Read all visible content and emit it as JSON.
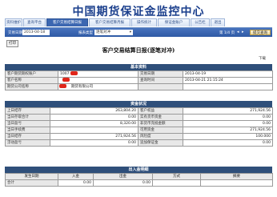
{
  "site_title": "中国期货保证金监控中心",
  "tabs": [
    "资料维护",
    "查询平台",
    "客户交易结算日报",
    "客户交易结算月报",
    "操作统计",
    "保证金账户",
    "公告栏",
    "退出"
  ],
  "active_tab": 2,
  "toolbar": {
    "date_label": "交易日期",
    "date_value": "2013-04-18",
    "type_label": "报表类型",
    "type_value": "逐笔对冲",
    "page_info": "第 1/4 页",
    "query_button": "提交查询"
  },
  "print_label": "打印",
  "report_title": "客户交易结算日报(逐笔对冲)",
  "download_label": "下载",
  "basic": {
    "heading": "基本资料",
    "rows": [
      [
        "客户期货期权账户",
        "1007",
        "交易日期",
        "2013-04-19"
      ],
      [
        "客户名称",
        "",
        "查询时间",
        "2013-04-21 21:15:24"
      ],
      [
        "期货公司名称",
        "",
        "",
        ""
      ]
    ],
    "company_suffix": "期货有限公司"
  },
  "funds": {
    "heading": "资金状况",
    "rows": [
      [
        "上日结存",
        "263,804.20",
        "客户权益",
        "271,924.56"
      ],
      [
        "当日存取合计",
        "0.00",
        "实有货币资金",
        "0.00"
      ],
      [
        "当日盈亏",
        "8,320.00",
        "非货币充抵金额",
        "0.00"
      ],
      [
        "当日手续费",
        "",
        "可用资金",
        "271,924.56"
      ],
      [
        "当日结存",
        "271,924.56",
        "风险度",
        "100.000"
      ],
      [
        "浮动盈亏",
        "0.00",
        "追加保证金",
        "0.00"
      ]
    ]
  },
  "inout": {
    "heading": "出入金明细",
    "columns": [
      "发生日期",
      "入金",
      "出金",
      "方式",
      "摘要"
    ],
    "total_label": "合计",
    "total_in": "0.00",
    "total_out": "0.00"
  }
}
